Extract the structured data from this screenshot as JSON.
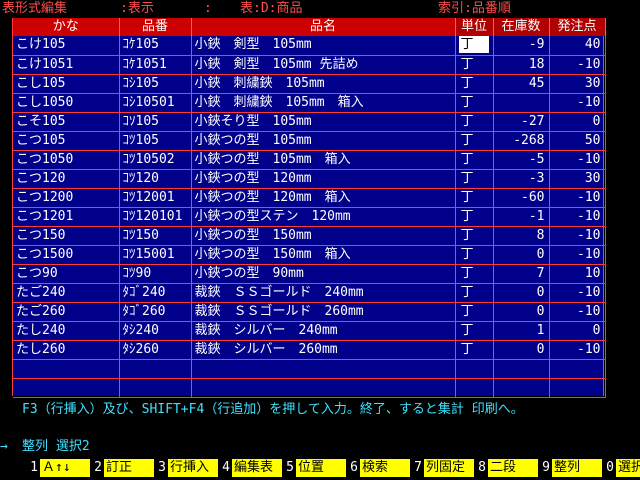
{
  "status": {
    "mode": "表形式編集",
    "view": ":表示",
    "colon": ":",
    "table": "表:D:商品",
    "index": "索引:品番順"
  },
  "columns": {
    "kana": "かな",
    "code": "品番",
    "name": "品名",
    "unit": "単位",
    "stock": "在庫数",
    "reorder": "発注点"
  },
  "rows": [
    {
      "kana": "こけ105",
      "code": "ｺｹ105",
      "name": "小鋏　剣型　105mm",
      "unit": "丁",
      "stock": "-9",
      "reorder": "40"
    },
    {
      "kana": "こけ1051",
      "code": "ｺｹ1051",
      "name": "小鋏　剣型　105mm 先詰め",
      "unit": "丁",
      "stock": "18",
      "reorder": "-10"
    },
    {
      "kana": "こし105",
      "code": "ｺｼ105",
      "name": "小鋏　刺繍鋏　105mm",
      "unit": "丁",
      "stock": "45",
      "reorder": "30"
    },
    {
      "kana": "こし1050",
      "code": "ｺｼ10501",
      "name": "小鋏　刺繍鋏　105mm　箱入",
      "unit": "丁",
      "stock": "",
      "reorder": "-10"
    },
    {
      "kana": "こそ105",
      "code": "ｺｿ105",
      "name": "小鋏そり型　105mm",
      "unit": "丁",
      "stock": "-27",
      "reorder": "0"
    },
    {
      "kana": "こつ105",
      "code": "ｺﾂ105",
      "name": "小鋏つの型　105mm",
      "unit": "丁",
      "stock": "-268",
      "reorder": "50"
    },
    {
      "kana": "こつ1050",
      "code": "ｺﾂ10502",
      "name": "小鋏つの型　105mm　箱入",
      "unit": "丁",
      "stock": "-5",
      "reorder": "-10"
    },
    {
      "kana": "こつ120",
      "code": "ｺﾂ120",
      "name": "小鋏つの型　120mm",
      "unit": "丁",
      "stock": "-3",
      "reorder": "30"
    },
    {
      "kana": "こつ1200",
      "code": "ｺﾂ12001",
      "name": "小鋏つの型　120mm　箱入",
      "unit": "丁",
      "stock": "-60",
      "reorder": "-10"
    },
    {
      "kana": "こつ1201",
      "code": "ｺﾂ120101",
      "name": "小鋏つの型ステン　120mm",
      "unit": "丁",
      "stock": "-1",
      "reorder": "-10"
    },
    {
      "kana": "こつ150",
      "code": "ｺﾂ150",
      "name": "小鋏つの型　150mm",
      "unit": "丁",
      "stock": "8",
      "reorder": "-10"
    },
    {
      "kana": "こつ1500",
      "code": "ｺﾂ15001",
      "name": "小鋏つの型　150mm　箱入",
      "unit": "丁",
      "stock": "0",
      "reorder": "-10"
    },
    {
      "kana": "こつ90",
      "code": "ｺﾂ90",
      "name": "小鋏つの型　90mm",
      "unit": "丁",
      "stock": "7",
      "reorder": "10"
    },
    {
      "kana": "たご240",
      "code": "ﾀｺﾞ240",
      "name": "裁鋏　ＳＳゴールド　240mm",
      "unit": "丁",
      "stock": "0",
      "reorder": "-10"
    },
    {
      "kana": "たご260",
      "code": "ﾀｺﾞ260",
      "name": "裁鋏　ＳＳゴールド　260mm",
      "unit": "丁",
      "stock": "0",
      "reorder": "-10"
    },
    {
      "kana": "たし240",
      "code": "ﾀｼ240",
      "name": "裁鋏　シルバー　240mm",
      "unit": "丁",
      "stock": "1",
      "reorder": "0"
    },
    {
      "kana": "たし260",
      "code": "ﾀｼ260",
      "name": "裁鋏　シルバー　260mm",
      "unit": "丁",
      "stock": "0",
      "reorder": "-10"
    }
  ],
  "help": "F3（行挿入）及び、SHIFT+F4（行追加）を押して入力。終了、すると集計 印刷へ。",
  "prompt": {
    "arrow": "→",
    "text": "整列 選択2"
  },
  "fkeys": [
    {
      "num": "1",
      "label": "Ａ↑↓"
    },
    {
      "num": "2",
      "label": "訂正"
    },
    {
      "num": "3",
      "label": "行挿入"
    },
    {
      "num": "4",
      "label": "編集表"
    },
    {
      "num": "5",
      "label": "位置"
    },
    {
      "num": "6",
      "label": "検索"
    },
    {
      "num": "7",
      "label": "列固定"
    },
    {
      "num": "8",
      "label": "二段"
    },
    {
      "num": "9",
      "label": "整列"
    },
    {
      "num": "0",
      "label": "選択"
    }
  ],
  "colors": {
    "background": "#000000",
    "grid": "#00008b",
    "header": "#cc0000",
    "status_text": "#ff4d4d",
    "help_text": "#40e0ff",
    "fkey_bg": "#ffff00"
  }
}
